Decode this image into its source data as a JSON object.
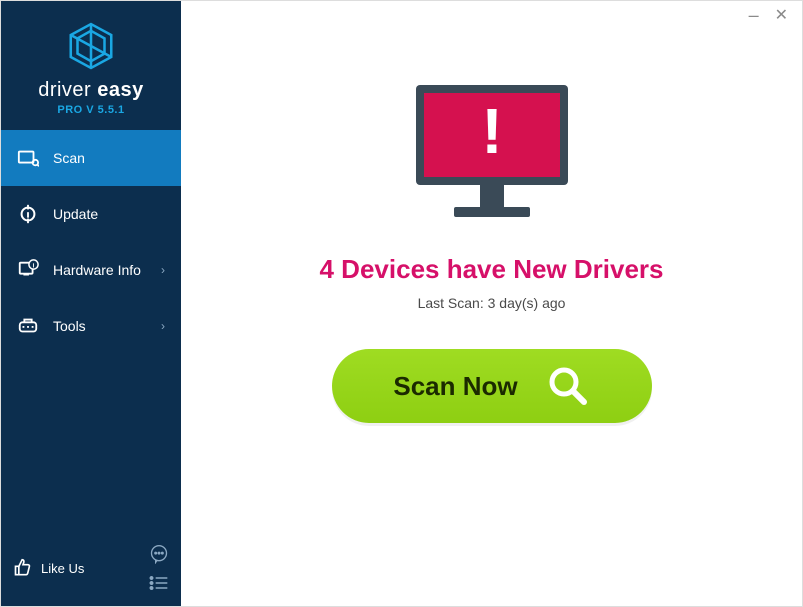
{
  "brand": {
    "name_light": "driver",
    "name_bold": "easy",
    "version": "PRO V 5.5.1"
  },
  "sidebar": {
    "items": [
      {
        "label": "Scan",
        "icon": "scan-icon",
        "active": true,
        "chevron": false
      },
      {
        "label": "Update",
        "icon": "update-icon",
        "active": false,
        "chevron": false
      },
      {
        "label": "Hardware Info",
        "icon": "hardware-icon",
        "active": false,
        "chevron": true
      },
      {
        "label": "Tools",
        "icon": "tools-icon",
        "active": false,
        "chevron": true
      }
    ],
    "like_label": "Like Us"
  },
  "main": {
    "headline": "4 Devices have New Drivers",
    "last_scan": "Last Scan: 3 day(s) ago",
    "scan_button": "Scan Now"
  },
  "colors": {
    "sidebar_bg": "#0c2e4e",
    "active_bg": "#127bbf",
    "accent_blue": "#1aa7e3",
    "headline": "#d61069",
    "scan_green": "#8ecf12",
    "monitor_red": "#d5114f"
  }
}
